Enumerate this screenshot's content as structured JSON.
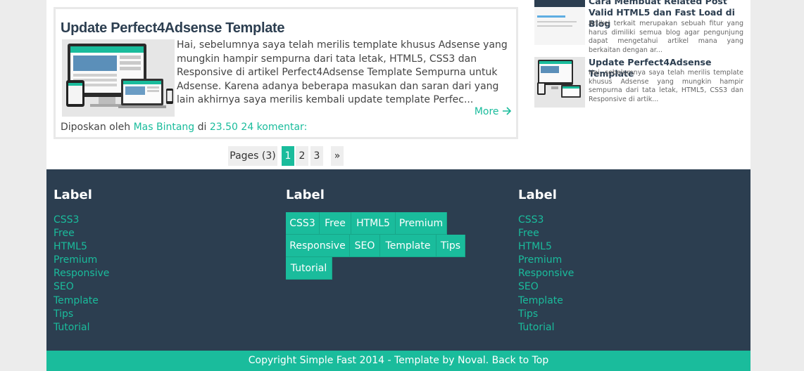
{
  "post": {
    "title": "Update Perfect4Adsense Template",
    "excerpt": "Hai, sebelumnya saya telah merilis template khusus Adsense yang mungkin hampir sempurna dari tata letak, HTML5, CSS3 dan Responsive di artikel Perfect4Adsense Template Sempurna untuk Adsense. Karena adanya beberapa masukan dan saran dari yang lain akhirnya saya merilis kembali update template Perfec...",
    "more_label": "More",
    "meta_prefix": "Diposkan oleh",
    "author": "Mas Bintang",
    "meta_at": "di",
    "time": "23.50",
    "comments": "24 komentar:"
  },
  "pagination": {
    "pages_label": "Pages (3)",
    "pages": [
      "1",
      "2",
      "3"
    ],
    "active": "1",
    "next_label": "»"
  },
  "sidebar": {
    "posts": [
      {
        "title": "Cara Membuat Related Post Valid HTML5 dan Fast Load di Blog",
        "snippet": "Artikel terkait merupakan sebuah fitur yang harus dimiliki semua blog agar pengunjung dapat mengetahui artikel mana yang berkaitan dengan ar..."
      },
      {
        "title": "Update Perfect4Adsense Template",
        "snippet": "Hai, sebelumnya saya telah merilis template khusus Adsense yang mungkin hampir sempurna dari tata letak, HTML5, CSS3 dan Responsive di artik..."
      }
    ]
  },
  "footer": {
    "widgets": [
      {
        "title": "Label"
      },
      {
        "title": "Label"
      },
      {
        "title": "Label"
      }
    ],
    "labels": [
      "CSS3",
      "Free",
      "HTML5",
      "Premium",
      "Responsive",
      "SEO",
      "Template",
      "Tips",
      "Tutorial"
    ],
    "copyright": "Copyright Simple Fast 2014 - Template by Noval. Back to Top"
  },
  "colors": {
    "accent": "#1abc9c",
    "footer_bg": "#2c3e50",
    "heading": "#2c3e50",
    "page_bg": "#ececec"
  },
  "icons": {
    "more_arrow": "arrow-right-icon"
  }
}
